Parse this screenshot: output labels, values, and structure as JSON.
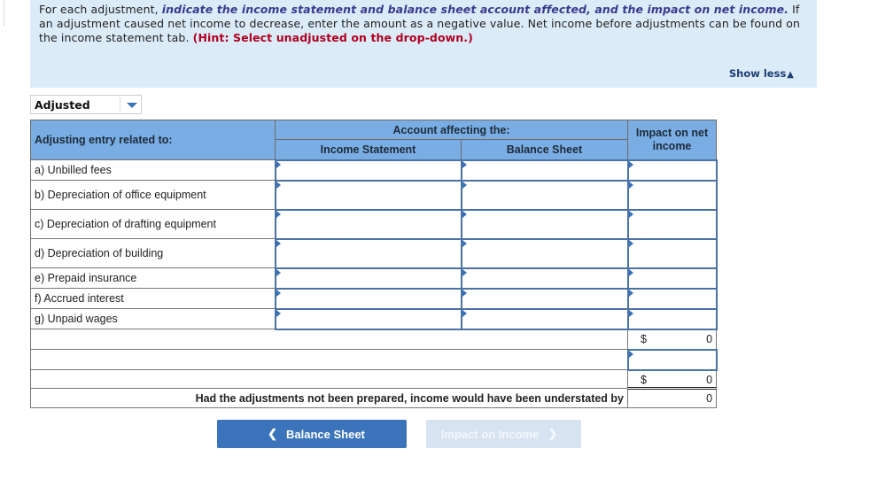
{
  "instructions": {
    "part1": "For each adjustment, ",
    "emphasis": "indicate the income statement and balance sheet account affected, and the impact on net income.",
    "part2": " If an adjustment caused net income to decrease, enter the amount as a negative value. Net income before adjustments can be found on the income statement tab. ",
    "hint": "(Hint: Select unadjusted on the drop-down.)",
    "show_less_label": "Show less",
    "show_less_icon": "triangle-up-icon"
  },
  "dropdown": {
    "selected": "Adjusted",
    "icon": "chevron-down-icon"
  },
  "table": {
    "headers": {
      "entry": "Adjusting entry related to:",
      "account_group": "Account affecting the:",
      "income_statement": "Income Statement",
      "balance_sheet": "Balance Sheet",
      "impact": "Impact on net income"
    },
    "rows": [
      {
        "label": "a) Unbilled fees",
        "income_statement": "",
        "balance_sheet": "",
        "impact": ""
      },
      {
        "label": "b)  Depreciation of office equipment",
        "income_statement": "",
        "balance_sheet": "",
        "impact": ""
      },
      {
        "label": "c)  Depreciation of drafting equipment",
        "income_statement": "",
        "balance_sheet": "",
        "impact": ""
      },
      {
        "label": "d)  Depreciation of building",
        "income_statement": "",
        "balance_sheet": "",
        "impact": ""
      },
      {
        "label": "e)  Prepaid insurance",
        "income_statement": "",
        "balance_sheet": "",
        "impact": ""
      },
      {
        "label": "f)  Accrued interest",
        "income_statement": "",
        "balance_sheet": "",
        "impact": ""
      },
      {
        "label": "g)  Unpaid wages",
        "income_statement": "",
        "balance_sheet": "",
        "impact": ""
      }
    ],
    "total_1": {
      "currency": "$",
      "value": "0"
    },
    "extra_input": "",
    "total_2": {
      "currency": "$",
      "value": "0"
    },
    "summary_label": "Had the adjustments not been prepared, income would have been understated by",
    "summary_value": "0"
  },
  "nav": {
    "prev_label": "Balance Sheet",
    "next_label": "Impact on Income",
    "prev_icon": "chevron-left-icon",
    "next_icon": "chevron-right-icon"
  }
}
